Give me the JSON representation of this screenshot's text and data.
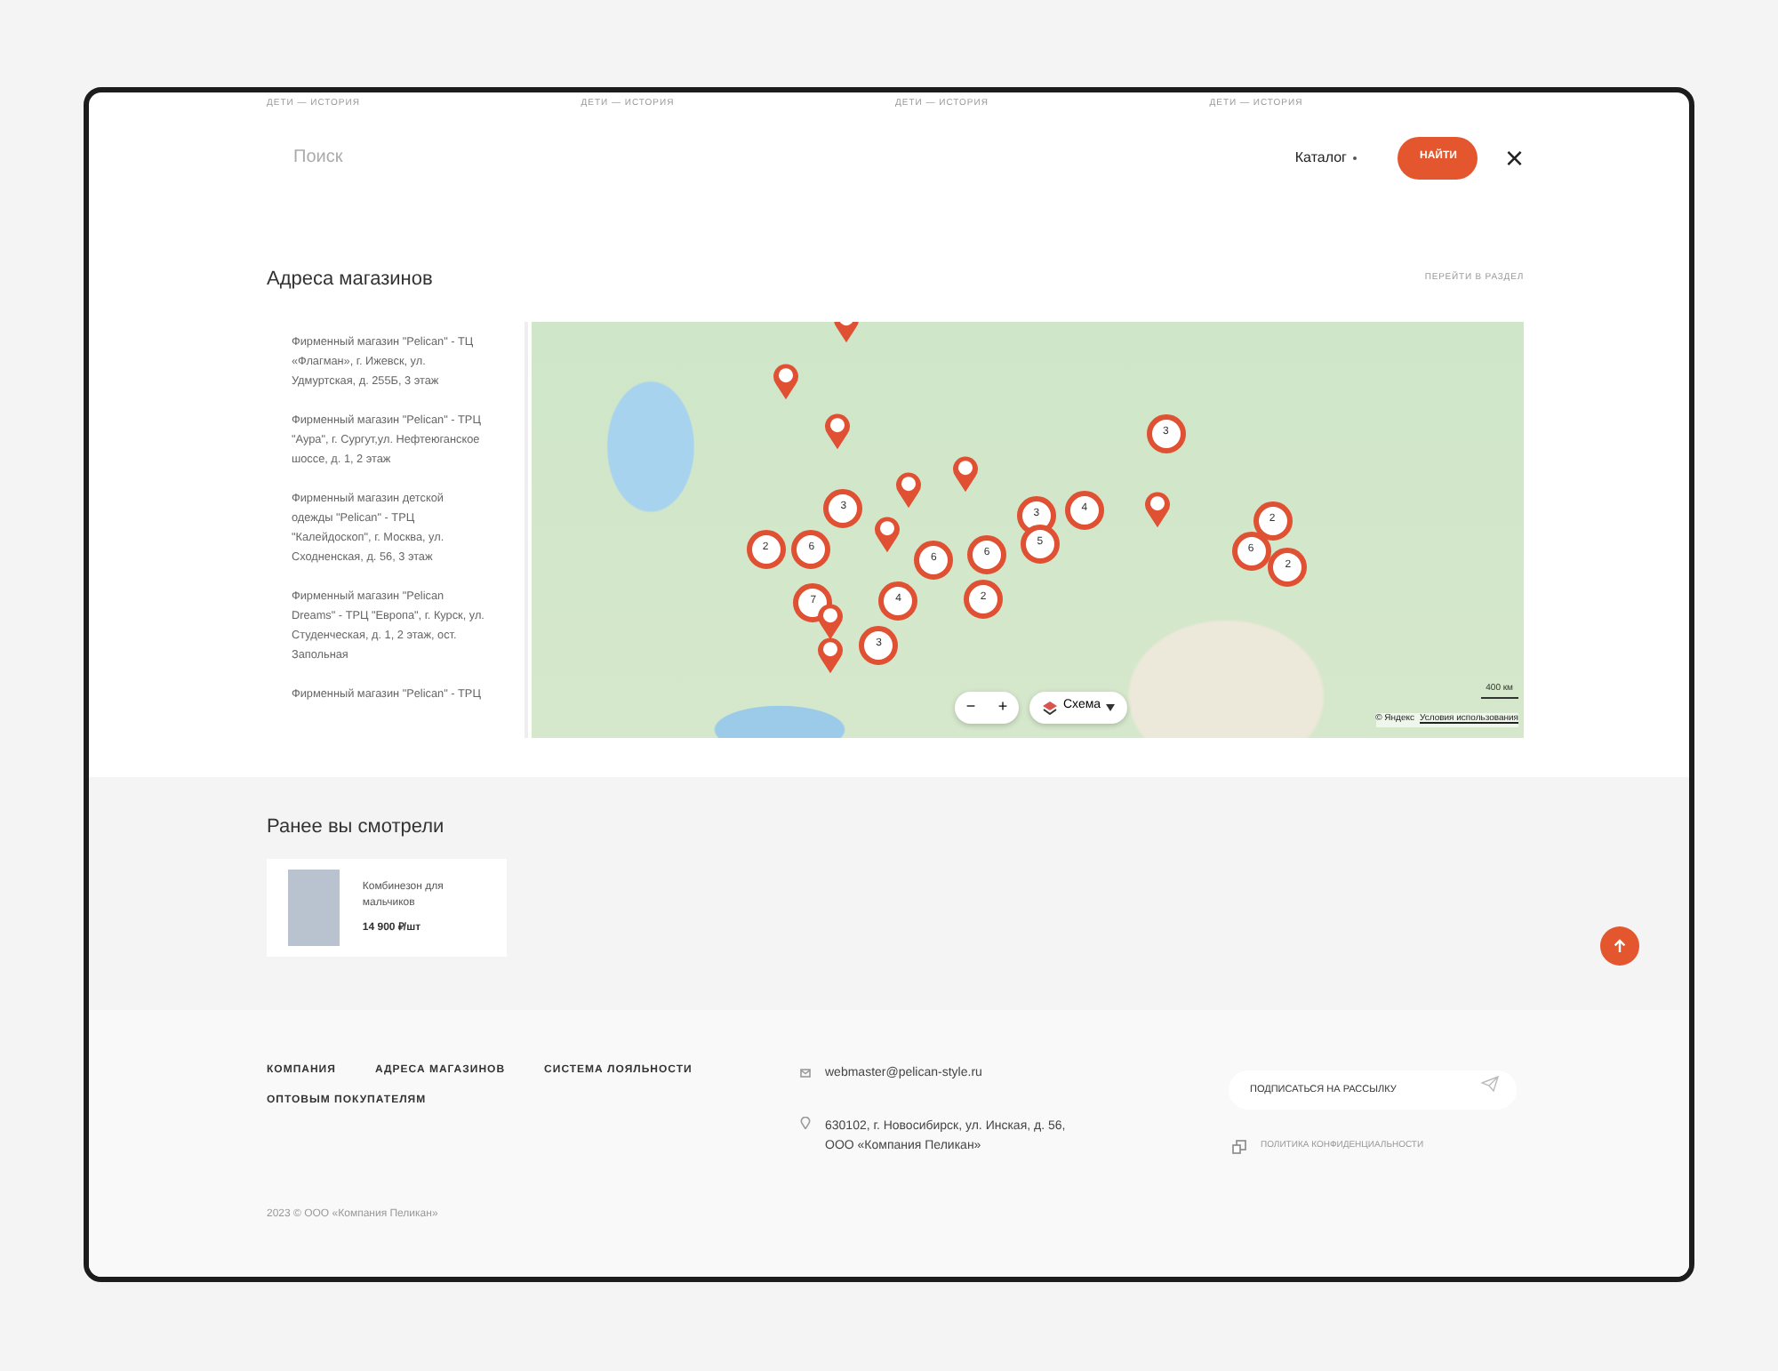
{
  "top_strip": [
    "ДЕТИ — ИСТОРИЯ",
    "ДЕТИ — ИСТОРИЯ",
    "ДЕТИ — ИСТОРИЯ",
    "ДЕТИ — ИСТОРИЯ"
  ],
  "search": {
    "placeholder": "Поиск",
    "catalog": "Каталог",
    "button": "НАЙТИ",
    "close": "×"
  },
  "stores": {
    "title": "Адреса магазинов",
    "link": "ПЕРЕЙТИ В РАЗДЕЛ",
    "items": [
      {
        "text": "Фирменный магазин \"Pelican\" - ТЦ «Флагман», г. Ижевск, ул. Удмуртская, д. 255Б, 3 этаж"
      },
      {
        "text": "Фирменный магазин \"Pelican\" - ТРЦ \"Аура\", г. Сургут,ул. Нефтеюганское шоссе, д. 1, 2 этаж"
      },
      {
        "text": "Фирменный магазин детской одежды \"Pelican\" - ТРЦ \"Калейдоскоп\", г. Москва, ул. Сходненская, д. 56, 3 этаж"
      },
      {
        "text": "Фирменный магазин \"Pelican Dreams\" - ТРЦ \"Европа\", г. Курск, ул. Студенческая, д. 1, 2 этаж, ост. Запольная"
      },
      {
        "text": "Фирменный магазин \"Pelican\" - ТРЦ"
      }
    ],
    "map": {
      "markers": [
        {
          "kind": "pin"
        },
        {
          "kind": "pin"
        },
        {
          "kind": "cluster",
          "label": "3"
        },
        {
          "kind": "pin"
        },
        {
          "kind": "pin"
        },
        {
          "kind": "pin"
        },
        {
          "kind": "cluster",
          "label": "3"
        },
        {
          "kind": "cluster",
          "label": "3"
        },
        {
          "kind": "cluster",
          "label": "4"
        },
        {
          "kind": "pin"
        },
        {
          "kind": "cluster",
          "label": "2"
        },
        {
          "kind": "cluster",
          "label": "2"
        },
        {
          "kind": "cluster",
          "label": "6"
        },
        {
          "kind": "pin"
        },
        {
          "kind": "cluster",
          "label": "6"
        },
        {
          "kind": "cluster",
          "label": "6"
        },
        {
          "kind": "cluster",
          "label": "5"
        },
        {
          "kind": "cluster",
          "label": "6"
        },
        {
          "kind": "cluster",
          "label": "2"
        },
        {
          "kind": "cluster",
          "label": "7"
        },
        {
          "kind": "cluster",
          "label": "4"
        },
        {
          "kind": "cluster",
          "label": "2"
        },
        {
          "kind": "pin"
        },
        {
          "kind": "cluster",
          "label": "3"
        },
        {
          "kind": "pin"
        }
      ],
      "zoom_out": "−",
      "zoom_in": "+",
      "layer_button": "Схема",
      "scale": "400 км",
      "copyright": "© Яндекс",
      "terms": "Условия использования"
    }
  },
  "recent": {
    "title": "Ранее вы смотрели",
    "items": [
      {
        "name": "Комбинезон для мальчиков",
        "price": "14 900 ₽/шт"
      }
    ]
  },
  "footer": {
    "links": [
      "КОМПАНИЯ",
      "АДРЕСА МАГАЗИНОВ",
      "СИСТЕМА ЛОЯЛЬНОСТИ",
      "ОПТОВЫМ ПОКУПАТЕЛЯМ"
    ],
    "email": "webmaster@pelican-style.ru",
    "address": "630102, г. Новосибирск, ул. Инская, д. 56,",
    "company": "ООО «Компания Пеликан»",
    "subscribe_placeholder": "ПОДПИСАТЬСЯ НА РАССЫЛКУ",
    "privacy": "ПОЛИТИКА КОНФИДЕНЦИАЛЬНОСТИ",
    "copyright": "2023 © ООО «Компания Пеликан»"
  }
}
